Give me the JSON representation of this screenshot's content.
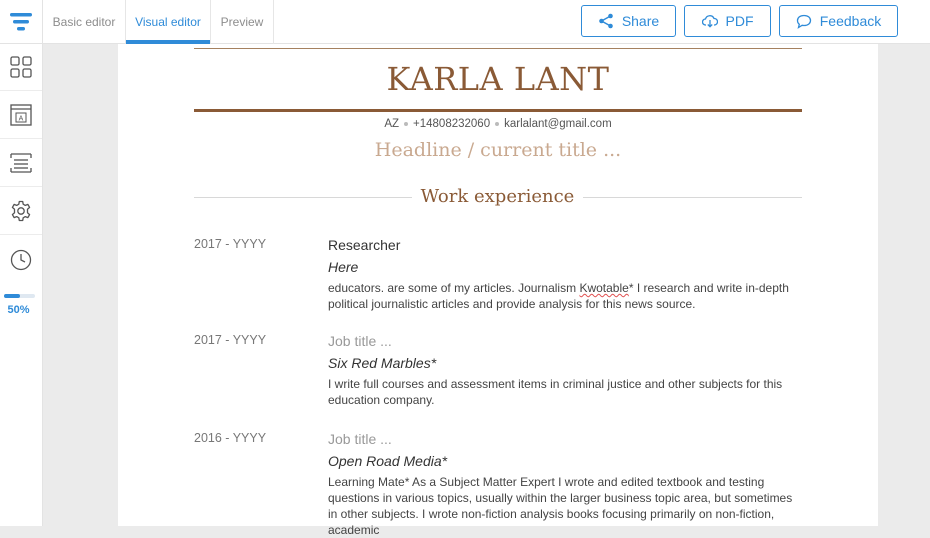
{
  "tabs": {
    "basic": "Basic editor",
    "visual": "Visual editor",
    "preview": "Preview"
  },
  "toolbar": {
    "share": "Share",
    "pdf": "PDF",
    "feedback": "Feedback"
  },
  "sidebar": {
    "progress_value": 0.5,
    "progress_label": "50%"
  },
  "resume": {
    "name": "KARLA LANT",
    "contact": {
      "location": "AZ",
      "phone": "+14808232060",
      "email": "karlalant@gmail.com"
    },
    "headline": "Headline / current title ...",
    "section_title": "Work experience",
    "entries": [
      {
        "date": "2017 - YYYY",
        "title": "Researcher",
        "company": "Here",
        "desc_pre": "educators. are some of my articles. Journalism ",
        "desc_flag": "Kwotable",
        "desc_post": "* I research and write in-depth political journalistic articles and provide analysis for this news source."
      },
      {
        "date": "2017 - YYYY",
        "title": "Job title ...",
        "company": "Six Red Marbles*",
        "desc": "I write full courses and assessment items in criminal justice and other subjects for this education company."
      },
      {
        "date": "2016 - YYYY",
        "title": "Job title ...",
        "company": "Open Road Media*",
        "desc": "Learning Mate* As a Subject Matter Expert I wrote and edited textbook and testing questions in various topics, usually within the larger business topic area, but sometimes in other subjects. I wrote non-fiction analysis books focusing primarily on non-fiction, academic"
      }
    ]
  },
  "colors": {
    "accent": "#2f8bd8",
    "brand_brown": "#8a5a36",
    "headline_placeholder": "#c9a990"
  }
}
